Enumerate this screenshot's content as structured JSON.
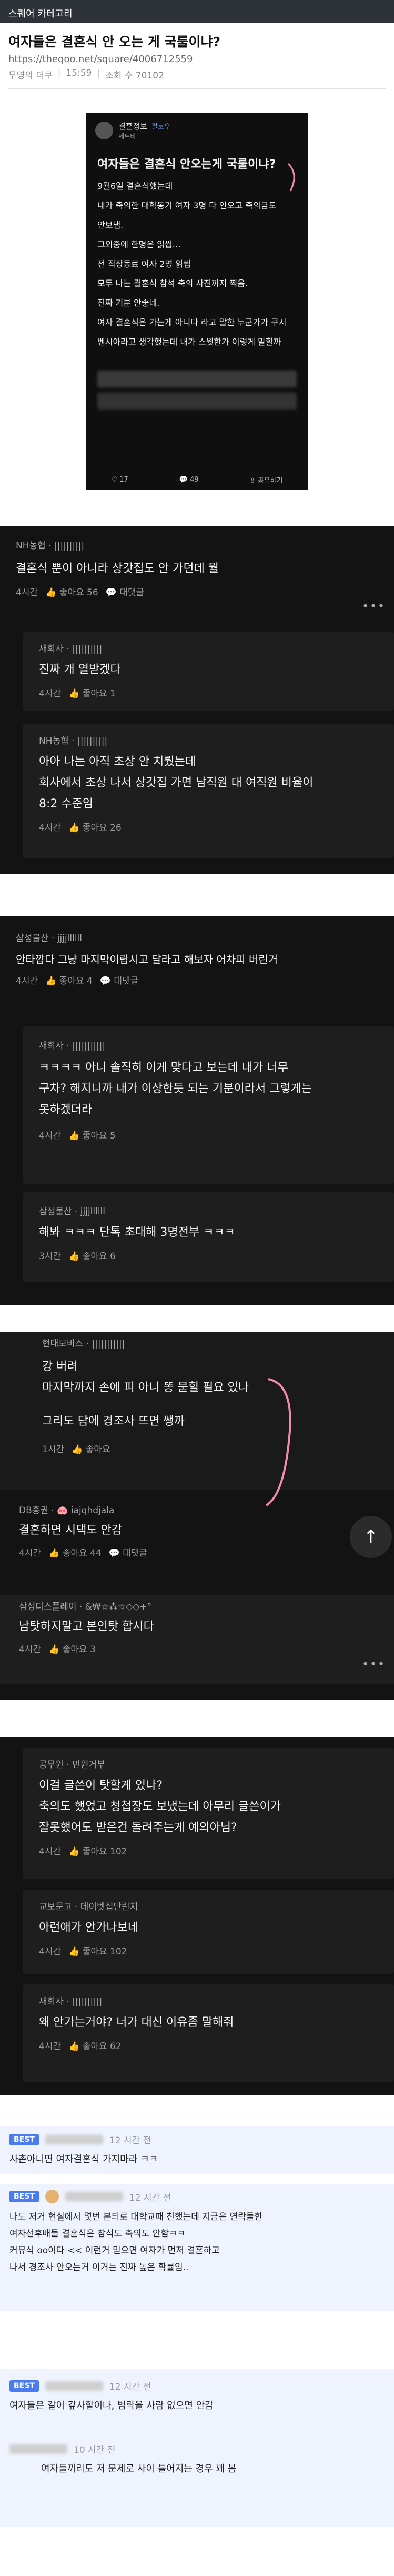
{
  "topbar": {
    "label": "스퀘어 카테고리"
  },
  "post": {
    "title": "여자들은 결혼식 안 오는 게 국룰이냐?",
    "url": "https://theqoo.net/square/4006712559",
    "author": "무명의 더쿠",
    "time": "15:59",
    "views_label": "조회 수 70102"
  },
  "shot1": {
    "username": "결혼정보",
    "sub": "세트비",
    "badge": "팔로우",
    "headline": "여자들은 결혼식 안오는게 국룰이냐?",
    "lines": [
      "9월6일 결혼식했는데",
      "내가 축의한 대학동기 여자 3명 다 안오고 축의금도",
      "안보냄.",
      "그외중에 한명은 읽씹…",
      "전 직장동료 여자 2명 읽씹",
      "모두 나는 결혼식 참석 축의 사진까지 찍음.",
      "진짜 기분 안좋네.",
      "여자 결혼식은 가는게 아니다 라고 말한 누군가가 쿠시",
      "벤시아라고 생각했는데 내가 스윗한가 이렇게 말할까"
    ],
    "likes": "17",
    "comments": "49",
    "share": "공유하기"
  },
  "shot2": {
    "c1": {
      "who": "NH농협 · ||||||||||",
      "text": "결혼식 뿐이 아니라 상갓집도 안 가던데 뭘",
      "time": "4시간",
      "likes": "좋아요 56",
      "reply": "대댓글"
    },
    "c2": {
      "who": "새회사 · ||||||||||",
      "text": "진짜 개 열받겠다",
      "time": "4시간",
      "likes": "좋아요 1"
    },
    "c3": {
      "who": "NH농협 · ||||||||||",
      "text1": "아아 나는 아직 초상 안 치뤘는데",
      "text2": "회사에서 초상 나서 상갓집 가면 남직원 대 여직원 비율이",
      "text3": "8:2 수준임",
      "time": "4시간",
      "likes": "좋아요 26"
    }
  },
  "shot3": {
    "c1": {
      "who": "삼성물산 · jjjjllllll",
      "text": "안타깝다 그냥 마지막이랍시고 달라고 해보자 어차피 버린거",
      "time": "4시간",
      "likes": "좋아요 4",
      "reply": "대댓글"
    },
    "c2": {
      "who": "새회사 · |||||||||||",
      "text1": "ㅋㅋㅋㅋ 아니 솔직히 이게 맞다고 보는데 내가 너무",
      "text2": "구차? 해지니까 내가 이상한듯 되는 기분이라서 그렇게는",
      "text3": "못하겠더라",
      "time": "4시간",
      "likes": "좋아요 5"
    },
    "c3": {
      "who": "삼성물산 · jjjjllllll",
      "text": "해봐 ㅋㅋㅋ 단톡 초대해 3명전부 ㅋㅋㅋ",
      "time": "3시간",
      "likes": "좋아요 6"
    }
  },
  "shot4": {
    "c1": {
      "who": "현대모비스 · |||||||||||",
      "text1": "강 버려",
      "text2": "마지막까지 손에 피 아니 똥 묻힐 필요 있나",
      "text3": "그리도 담에 경조사 뜨면 쌩까",
      "time": "1시간",
      "likes": "좋아요"
    },
    "c2": {
      "who": "DB종권 · 🐽 iajqhdjala",
      "text": "결혼하면 시댁도 안감",
      "time": "4시간",
      "likes": "좋아요 44",
      "reply": "대댓글"
    },
    "c3": {
      "who": "삼성디스플레이 · &₩☆⁂☆◇◇+°",
      "text": "남탓하지말고 본인탓 합시다",
      "time": "4시간",
      "likes": "좋아요 3"
    }
  },
  "shot5": {
    "c1": {
      "who": "공무원 · 민원거부",
      "text1": "이걸 글쓴이 탓할게 있나?",
      "text2": "축의도 했었고 청첩장도 보냈는데 아무리 글쓴이가",
      "text3": "잘못했어도 받은건 돌려주는게 예의아님?",
      "time": "4시간",
      "likes": "좋아요 102"
    },
    "c2": {
      "who": "교보문고 · 데이벳집단린치",
      "text": "아런애가 안가나보네",
      "time": "4시간",
      "likes": "좋아요 102"
    },
    "c3": {
      "who": "새회사 · ||||||||||",
      "text": "왜 안가는거야? 너가 대신 이유좀 말해줘",
      "time": "4시간",
      "likes": "좋아요 62"
    }
  },
  "comments": [
    {
      "best": "BEST",
      "time": "12 시간 전",
      "body": [
        "사촌아니면 여자결혼식 가지마라 ㅋㅋ"
      ]
    },
    {
      "best": "BEST",
      "time": "12 시간 전",
      "body": [
        "나도 저거 현실에서 몇번 본듸로 대학교때 친했는데 지금은 연락들한",
        "여자선후배들 결혼식은 참석도 축의도 안함ㅋㅋ",
        "커뮤식 oo이다 << 이런거 믿으면 여자가 먼저 결혼하고",
        "나서 경조사 안오는거 이거는 진짜 높은 확률임.."
      ]
    },
    {
      "best": "BEST",
      "time": "12 시간 전",
      "body": [
        "여자들은 갈이 갚사할이나, 범락을 사람 없으면 안감"
      ]
    },
    {
      "best": "",
      "time": "10 시간 전",
      "body": [
        "여자들끼리도 저 문제로 사이 틀어지는 경우 꽤 봄"
      ]
    }
  ],
  "scroll_top": "↑",
  "colors": {
    "accent": "#4a7cf0",
    "dark_bg": "#131313"
  }
}
